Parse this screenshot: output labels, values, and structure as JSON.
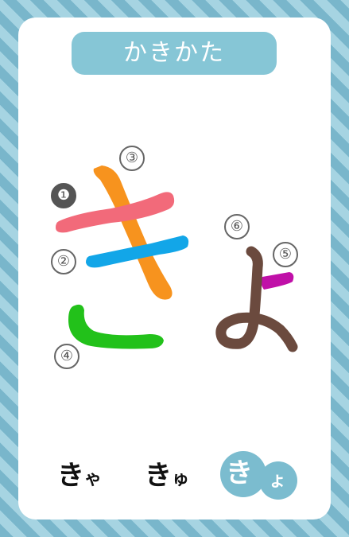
{
  "card": {
    "title": "かきかた",
    "stroke_numbers": [
      "❶",
      "②",
      "③",
      "④",
      "⑤",
      "⑥"
    ],
    "stroke_colors": {
      "1": "#f26a7a",
      "2": "#12a6e8",
      "3": "#f7931e",
      "4": "#22c11a",
      "5": "#c010a8",
      "6": "#6b4a3e"
    }
  },
  "combinations": {
    "kya": {
      "main": "き",
      "small": "ゃ"
    },
    "kyu": {
      "main": "き",
      "small": "ゅ"
    },
    "kyo": {
      "main": "き",
      "small": "ょ"
    }
  },
  "colors": {
    "frame_light": "#a6d4e2",
    "frame_dark": "#79b6cb",
    "pill": "#86c6d6"
  }
}
